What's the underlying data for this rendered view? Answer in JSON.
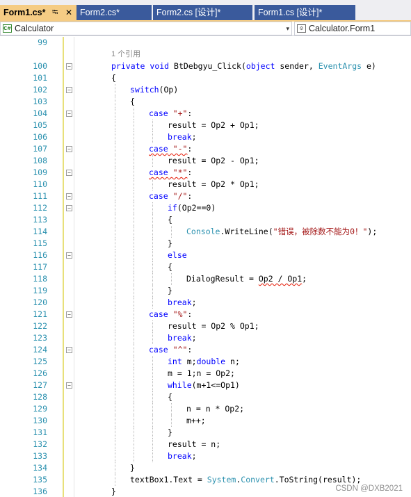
{
  "tabs": [
    {
      "label": "Form1.cs*",
      "active": true,
      "pin": "⭾",
      "close": "✕"
    },
    {
      "label": "Form2.cs*",
      "active": false
    },
    {
      "label": "Form2.cs [设计]*",
      "active": false
    },
    {
      "label": "Form1.cs [设计]*",
      "active": false
    }
  ],
  "nav": {
    "project": "Calculator",
    "member": "Calculator.Form1",
    "project_icon": "C#",
    "dropdown_icon": "▾"
  },
  "editor": {
    "ref_hint": "1 个引用",
    "lines": [
      {
        "n": "99",
        "indent": 0,
        "html": ""
      },
      {
        "n": "100",
        "indent": 0,
        "fold": "-",
        "html": "<span class=\"kw\">private</span> <span class=\"kw\">void</span> BtDebgyu_Click(<span class=\"kw\">object</span> sender, <span class=\"typ\">EventArgs</span> e)"
      },
      {
        "n": "101",
        "indent": 0,
        "html": "{"
      },
      {
        "n": "102",
        "indent": 1,
        "fold": "-",
        "html": "<span class=\"kw\">switch</span>(Op)"
      },
      {
        "n": "103",
        "indent": 1,
        "html": "{"
      },
      {
        "n": "104",
        "indent": 2,
        "fold": "-",
        "html": "<span class=\"kw\">case</span> <span class=\"str\">\"+\"</span>:"
      },
      {
        "n": "105",
        "indent": 3,
        "html": "result = Op2 + Op1;"
      },
      {
        "n": "106",
        "indent": 3,
        "html": "<span class=\"kw\">break</span>;"
      },
      {
        "n": "107",
        "indent": 2,
        "fold": "-",
        "html": "<span class=\"kw squig\">case</span><span class=\"squig\"> </span><span class=\"str squig\">\"-\"</span>:"
      },
      {
        "n": "108",
        "indent": 3,
        "html": "result = Op2 - Op1;"
      },
      {
        "n": "109",
        "indent": 2,
        "fold": "-",
        "html": "<span class=\"kw squig\">case</span><span class=\"squig\"> </span><span class=\"str squig\">\"*\"</span>:"
      },
      {
        "n": "110",
        "indent": 3,
        "html": "result = Op2 * Op1;"
      },
      {
        "n": "111",
        "indent": 2,
        "fold": "-",
        "html": "<span class=\"kw\">case</span> <span class=\"str\">\"/\"</span>:"
      },
      {
        "n": "112",
        "indent": 3,
        "fold": "-",
        "html": "<span class=\"kw\">if</span>(Op2==0)"
      },
      {
        "n": "113",
        "indent": 3,
        "html": "{"
      },
      {
        "n": "114",
        "indent": 4,
        "html": "<span class=\"typ\">Console</span>.WriteLine(<span class=\"str\">\"错误，被除数不能为0！\"</span>);"
      },
      {
        "n": "115",
        "indent": 3,
        "html": "}"
      },
      {
        "n": "116",
        "indent": 3,
        "fold": "-",
        "html": "<span class=\"kw\">else</span>"
      },
      {
        "n": "117",
        "indent": 3,
        "html": "{"
      },
      {
        "n": "118",
        "indent": 4,
        "html": "DialogResult = <span class=\"squig\">Op2 / Op1</span>;"
      },
      {
        "n": "119",
        "indent": 3,
        "html": "}"
      },
      {
        "n": "120",
        "indent": 3,
        "html": "<span class=\"kw\">break</span>;"
      },
      {
        "n": "121",
        "indent": 2,
        "fold": "-",
        "html": "<span class=\"kw\">case</span> <span class=\"str\">\"%\"</span>:"
      },
      {
        "n": "122",
        "indent": 3,
        "html": "result = Op2 % Op1;"
      },
      {
        "n": "123",
        "indent": 3,
        "html": "<span class=\"kw\">break</span>;"
      },
      {
        "n": "124",
        "indent": 2,
        "fold": "-",
        "html": "<span class=\"kw\">case</span> <span class=\"str\">\"^\"</span>:"
      },
      {
        "n": "125",
        "indent": 3,
        "html": "<span class=\"kw\">int</span> m;<span class=\"kw\">double</span> n;"
      },
      {
        "n": "126",
        "indent": 3,
        "html": "m = 1;n = Op2;"
      },
      {
        "n": "127",
        "indent": 3,
        "fold": "-",
        "html": "<span class=\"kw\">while</span>(m+1&lt;=Op1)"
      },
      {
        "n": "128",
        "indent": 3,
        "html": "{"
      },
      {
        "n": "129",
        "indent": 4,
        "html": "n = n * Op2;"
      },
      {
        "n": "130",
        "indent": 4,
        "html": "m++;"
      },
      {
        "n": "131",
        "indent": 3,
        "html": "}"
      },
      {
        "n": "132",
        "indent": 3,
        "html": "result = n;"
      },
      {
        "n": "133",
        "indent": 3,
        "html": "<span class=\"kw\">break</span>;"
      },
      {
        "n": "134",
        "indent": 1,
        "html": "}"
      },
      {
        "n": "135",
        "indent": 1,
        "html": "textBox1.Text = <span class=\"typ\">System</span>.<span class=\"typ\">Convert</span>.ToString(result);"
      },
      {
        "n": "136",
        "indent": 0,
        "html": "}"
      }
    ]
  },
  "watermark": "CSDN @DXB2021",
  "colors": {
    "active_tab": "#f5cc84",
    "inactive_tab": "#3a5a9c",
    "line_number": "#2b91af",
    "keyword": "#0000ff",
    "string": "#a31515",
    "type": "#2b91af",
    "error_squiggle": "#e51400"
  }
}
